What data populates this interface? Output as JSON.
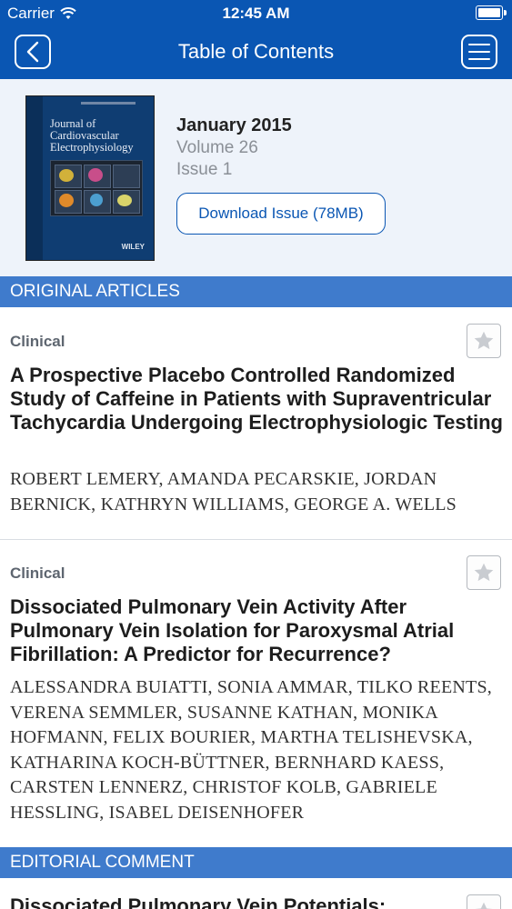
{
  "status_bar": {
    "carrier": "Carrier",
    "time": "12:45 AM"
  },
  "nav": {
    "title": "Table of Contents"
  },
  "issue": {
    "cover_title": "Journal of Cardiovascular Electrophysiology",
    "cover_publisher": "WILEY",
    "date": "January 2015",
    "volume": "Volume 26",
    "issue": "Issue 1",
    "download_label": "Download Issue (78MB)"
  },
  "sections": [
    {
      "heading": "ORIGINAL ARTICLES",
      "articles": [
        {
          "category": "Clinical",
          "title": "A Prospective Placebo Controlled Randomized Study of Caffeine in Patients with Supraventricular Tachycardia Undergoing Electrophysiologic Testing",
          "authors": "ROBERT LEMERY, AMANDA PECARSKIE, JORDAN BERNICK, KATHRYN WILLIAMS, GEORGE A. WELLS"
        },
        {
          "category": "Clinical",
          "title": "Dissociated Pulmonary Vein Activity After Pulmonary Vein Isolation for Paroxysmal Atrial Fibrillation: A Predictor for Recurrence?",
          "authors": "ALESSANDRA BUIATTI, SONIA AMMAR, TILKO REENTS, VERENA SEMMLER, SUSANNE KATHAN, MONIKA HOFMANN, FELIX BOURIER, MARTHA TELISHEVSKA, KATHARINA KOCH-BÜTTNER, BERNHARD KAESS, CARSTEN LENNERZ, CHRISTOF KOLB, GABRIELE HESSLING, ISABEL DEISENHOFER"
        }
      ]
    },
    {
      "heading": "EDITORIAL COMMENT",
      "articles": [
        {
          "title": "Dissociated Pulmonary Vein Potentials:"
        }
      ]
    }
  ],
  "colors": {
    "nav": "#0a56b3",
    "section": "#3f7bcc",
    "header_bg": "#eef3fa"
  }
}
